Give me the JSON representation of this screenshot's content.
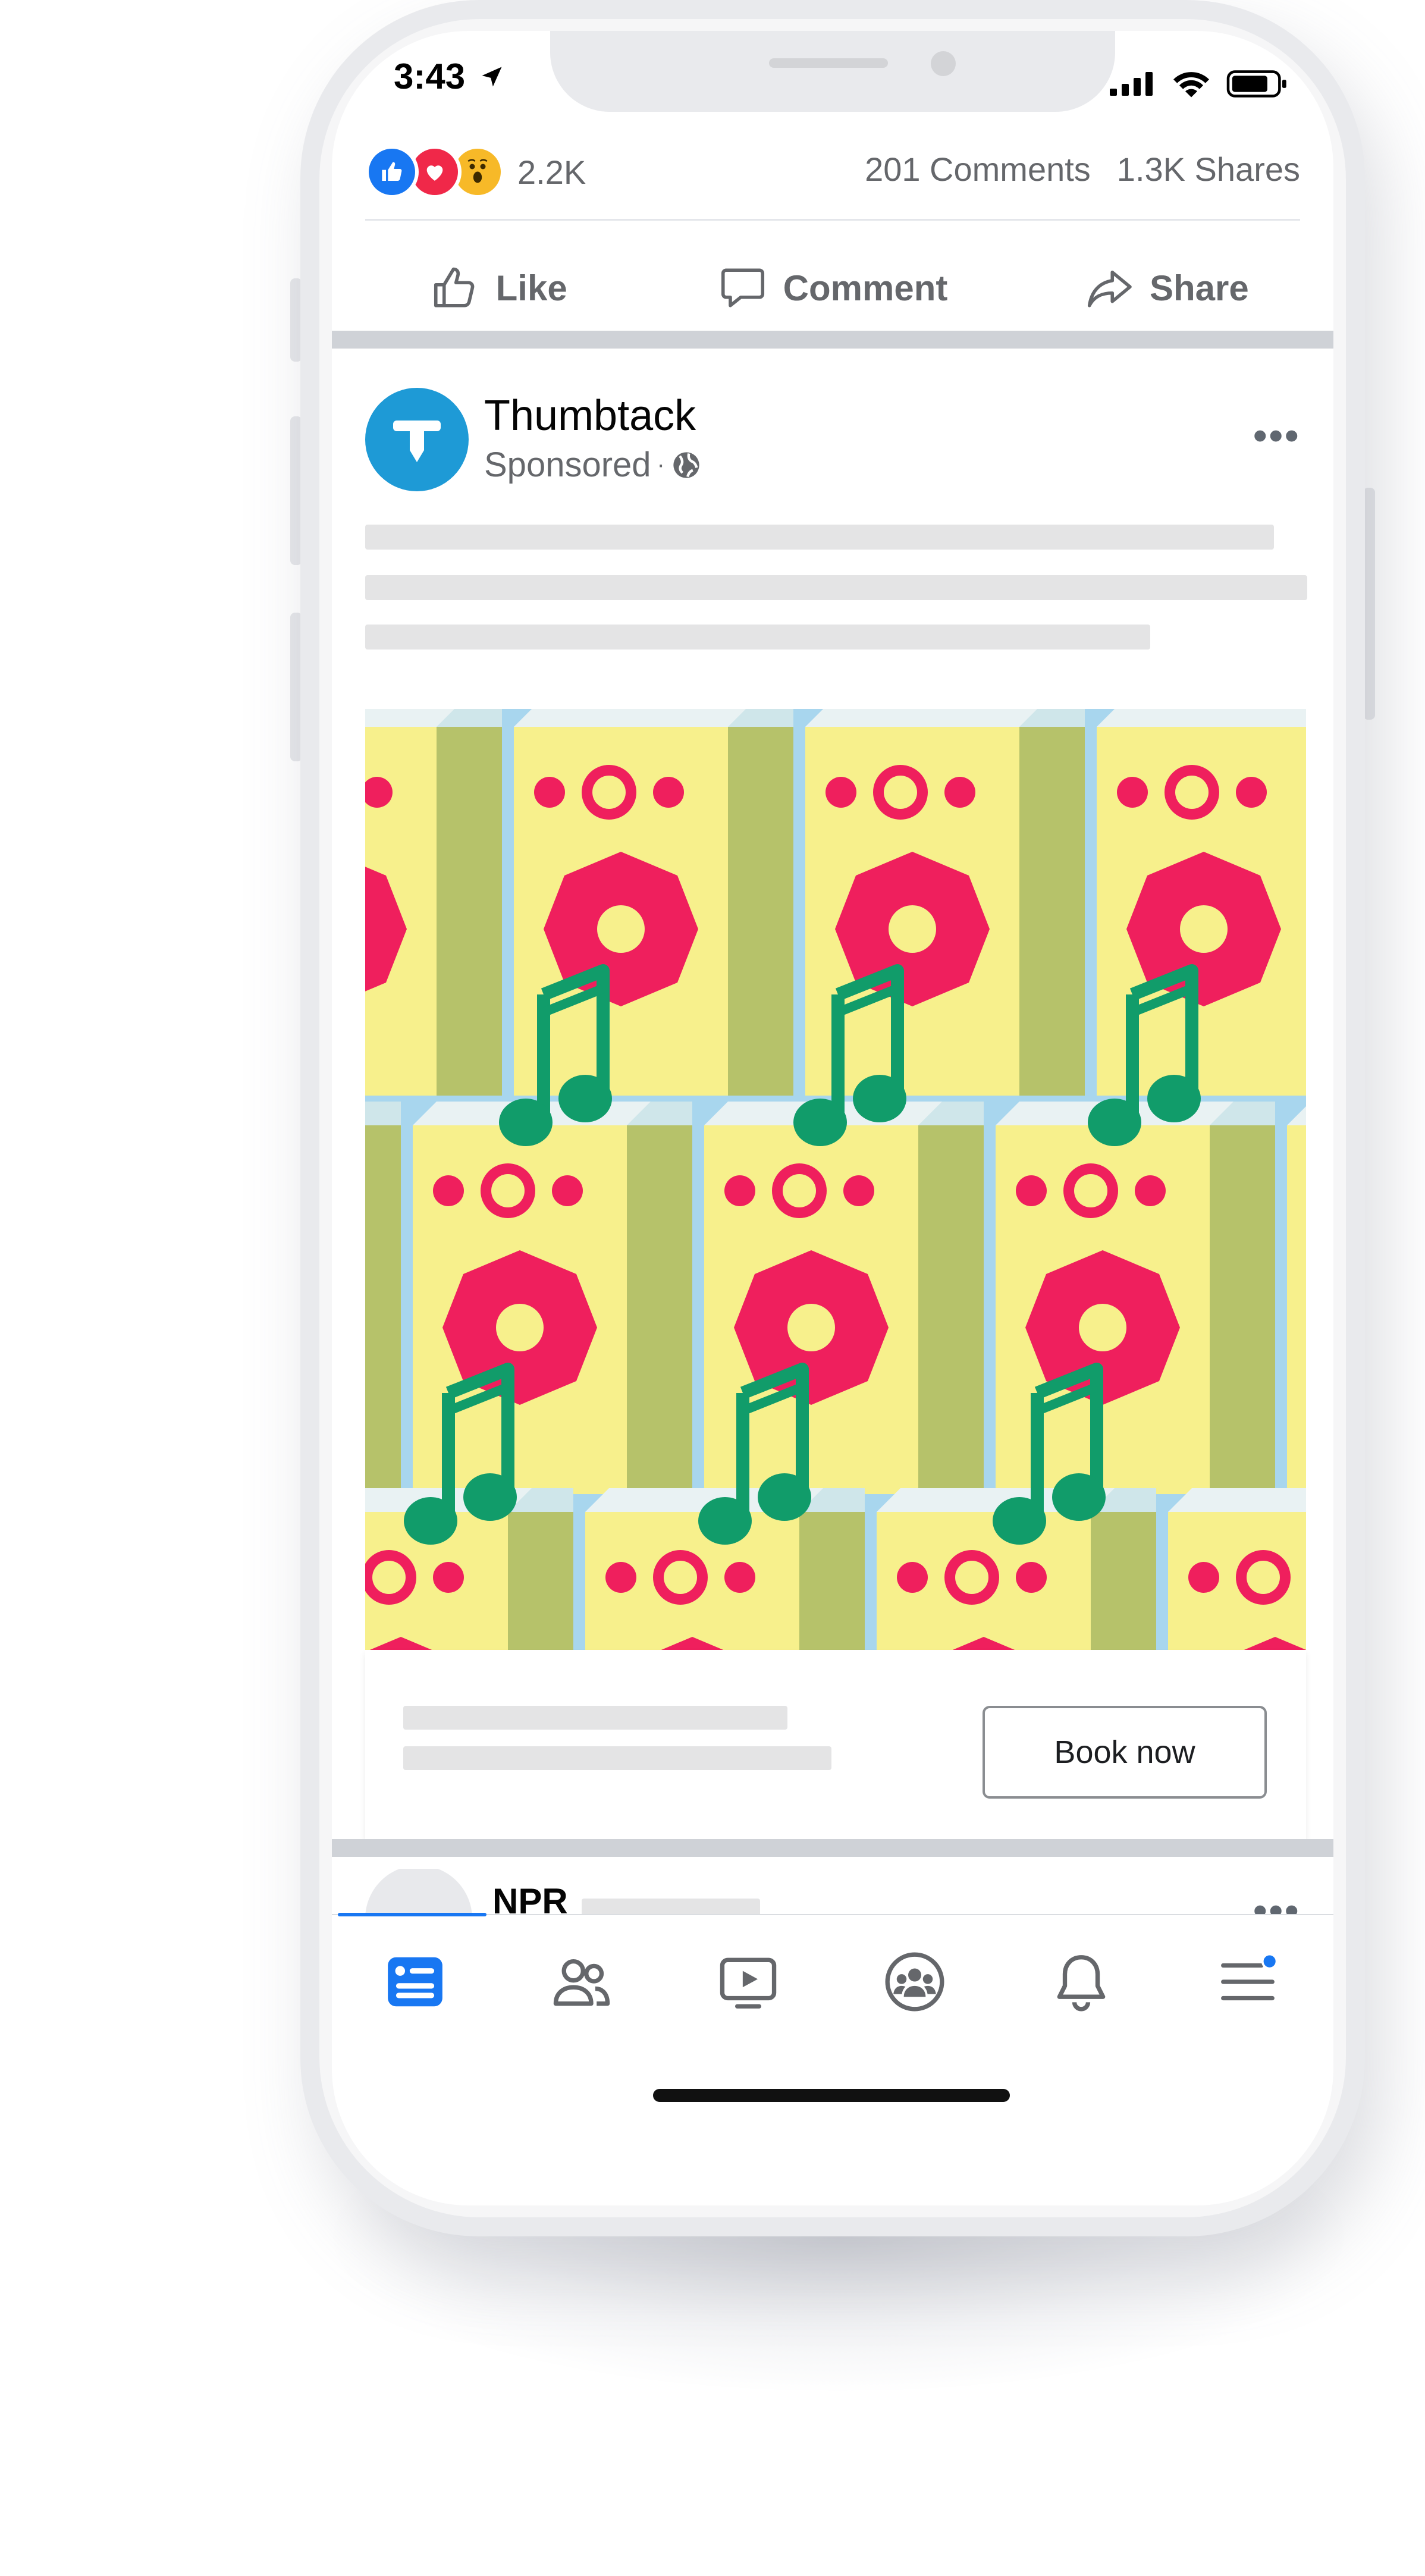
{
  "status_bar": {
    "time": "3:43"
  },
  "engagement": {
    "reaction_count": "2.2K",
    "comments": "201 Comments",
    "shares": "1.3K Shares"
  },
  "actions": {
    "like": "Like",
    "comment": "Comment",
    "share": "Share"
  },
  "post": {
    "page_name": "Thumbtack",
    "avatar_letter": "T",
    "sponsored": "Sponsored",
    "cta_label": "Book now"
  },
  "next_post": {
    "page_name": "NPR"
  },
  "colors": {
    "facebook_blue": "#1877f2",
    "thumbtack_blue": "#1e9ad6",
    "text_secondary": "#65676b",
    "speaker_yellow": "#f7f08c",
    "speaker_red": "#ef1f5d",
    "note_green": "#119c6a",
    "background_blue": "#a8d6ee"
  },
  "icons": {
    "tabs": [
      "news-feed-icon",
      "friends-icon",
      "watch-icon",
      "groups-icon",
      "notifications-icon",
      "menu-icon"
    ]
  }
}
